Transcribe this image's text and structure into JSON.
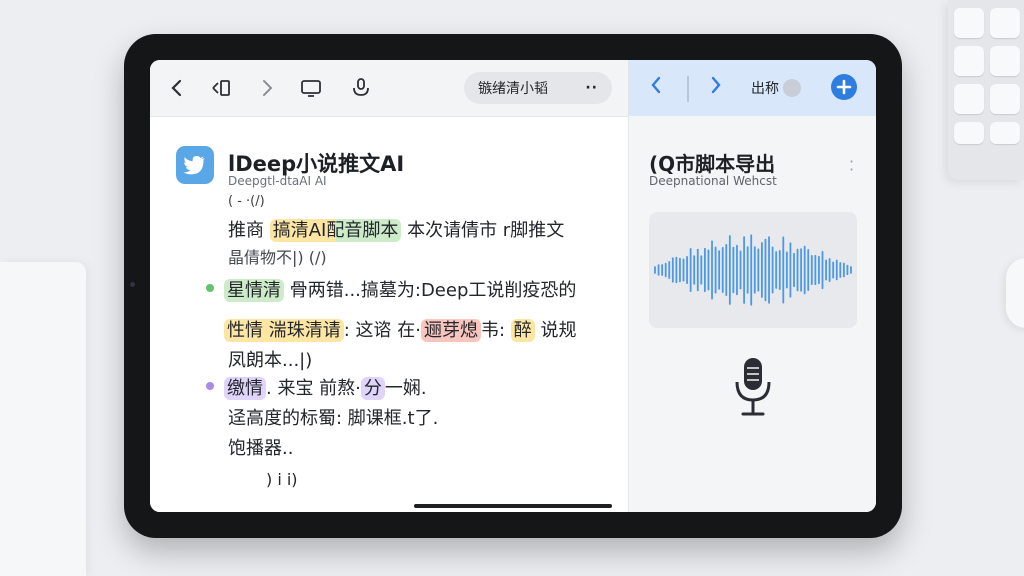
{
  "toolbar": {
    "search_text": "镞绪清小韬",
    "search_more": "··"
  },
  "right_toolbar": {
    "export_label": "出称"
  },
  "editor": {
    "app_title": "lDeep小说推文AI",
    "app_subtitle": "Deepgtl-dtaAI AI",
    "line_paren1": "(   -  ·(/)",
    "line1_parts": [
      {
        "text": "推商 ",
        "hl": ""
      },
      {
        "text": "搞清AI配音脚本",
        "hl": "mixed"
      },
      {
        "text": " 本次请倩市 r脚推文",
        "hl": ""
      }
    ],
    "line2": "晶倩物不|)     (/)",
    "tag_green": "星情清",
    "line3_rest": "  骨两错...搞墓为:Deep工说削疫恐的",
    "line4_parts": [
      {
        "text": "性情 湍珠清请",
        "hl": "yellow"
      },
      {
        "text": ": 这谘 在·",
        "hl": ""
      },
      {
        "text": "逦芽熄",
        "hl": "red"
      },
      {
        "text": "韦: ",
        "hl": ""
      },
      {
        "text": "醉",
        "hl": "yellow"
      },
      {
        "text": " 说规",
        "hl": ""
      }
    ],
    "line5": "凤朗本...|)",
    "tag_purple": "缴情",
    "line6_mid": ". 来宝  前熬·",
    "tag_purple2": "分",
    "line6_end": "一娴.",
    "line7": "迳高度的标蜀: 脚课框.t了.",
    "line8": "饱播器..",
    "line9": ")    i  i)"
  },
  "panel": {
    "title": "(Q市脚本导出",
    "subtitle": "Deepnational Wehcst"
  },
  "colors": {
    "accent": "#2f7de1",
    "highlight_yellow": "#fde6a4",
    "highlight_green": "#cdebc9",
    "highlight_red": "#f9c5bf",
    "highlight_purple": "#e1d4fb",
    "wave": "#4b98e6"
  }
}
